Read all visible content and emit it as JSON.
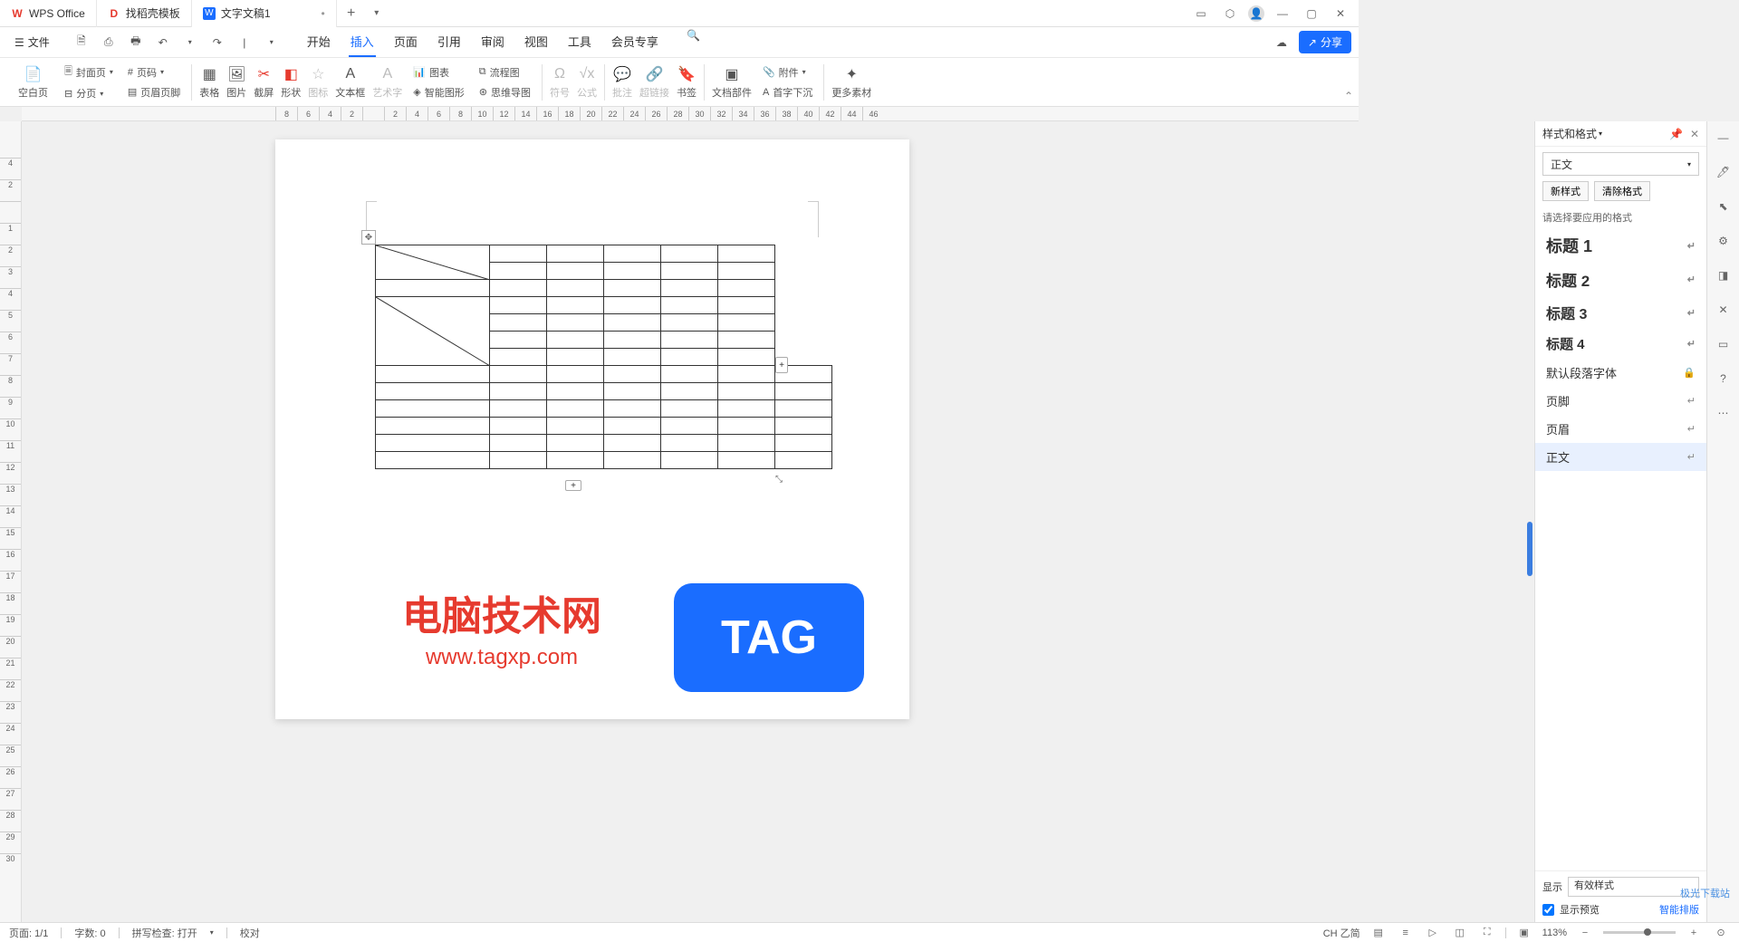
{
  "tabs": [
    {
      "label": "WPS Office",
      "icon": "W",
      "iconColor": "#e63a2e"
    },
    {
      "label": "找稻壳模板",
      "icon": "D",
      "iconColor": "#e63a2e"
    },
    {
      "label": "文字文稿1",
      "icon": "W",
      "iconColor": "#1a6dff",
      "modified": "•"
    }
  ],
  "fileMenu": "文件",
  "menuTabs": [
    "开始",
    "插入",
    "页面",
    "引用",
    "审阅",
    "视图",
    "工具",
    "会员专享"
  ],
  "activeMenuTab": 1,
  "shareBtn": "分享",
  "ribbon": {
    "blank": "空白页",
    "cover": "封面页",
    "pageNum": "页码",
    "pageBreak": "分页",
    "headerFooter": "页眉页脚",
    "table": "表格",
    "picture": "图片",
    "screenshot": "截屏",
    "shape": "形状",
    "icon": "图标",
    "textbox": "文本框",
    "wordart": "艺术字",
    "chart": "图表",
    "smartart": "智能图形",
    "flowchart": "流程图",
    "mindmap": "思维导图",
    "symbol": "符号",
    "equation": "公式",
    "comment": "批注",
    "hyperlink": "超链接",
    "bookmark": "书签",
    "docParts": "文档部件",
    "attachment": "附件",
    "dropCap": "首字下沉",
    "moreMaterial": "更多素材"
  },
  "hruler": [
    "8",
    "6",
    "4",
    "2",
    "",
    "2",
    "4",
    "6",
    "8",
    "10",
    "12",
    "14",
    "16",
    "18",
    "20",
    "22",
    "24",
    "26",
    "28",
    "30",
    "32",
    "34",
    "36",
    "38",
    "40",
    "42",
    "44",
    "46"
  ],
  "vruler": [
    "4",
    "2",
    "",
    "1",
    "2",
    "3",
    "4",
    "5",
    "6",
    "7",
    "8",
    "9",
    "10",
    "11",
    "12",
    "13",
    "14",
    "15",
    "16",
    "17",
    "18",
    "19",
    "20",
    "21",
    "22",
    "23",
    "24",
    "25",
    "26",
    "27",
    "28",
    "29",
    "30"
  ],
  "sidePanel": {
    "title": "样式和格式",
    "currentStyle": "正文",
    "newStyle": "新样式",
    "clearFormat": "清除格式",
    "hint": "请选择要应用的格式",
    "styles": [
      {
        "name": "标题 1",
        "cls": "h1"
      },
      {
        "name": "标题 2",
        "cls": "h2"
      },
      {
        "name": "标题 3",
        "cls": "h3"
      },
      {
        "name": "标题 4",
        "cls": "h4"
      },
      {
        "name": "默认段落字体",
        "cls": "",
        "lock": "🔒"
      },
      {
        "name": "页脚",
        "cls": ""
      },
      {
        "name": "页眉",
        "cls": ""
      },
      {
        "name": "正文",
        "cls": "",
        "selected": true
      }
    ],
    "showLabel": "显示",
    "showValue": "有效样式",
    "previewLabel": "显示预览",
    "smartLayout": "智能排版"
  },
  "statusbar": {
    "page": "页面: 1/1",
    "words": "字数: 0",
    "spell": "拼写检查: 打开",
    "proof": "校对",
    "zoom": "113%",
    "ime": "CH 乙简"
  },
  "watermark": {
    "line1": "电脑技术网",
    "line2": "www.tagxp.com",
    "tag": "TAG",
    "site": "极光下载站"
  }
}
